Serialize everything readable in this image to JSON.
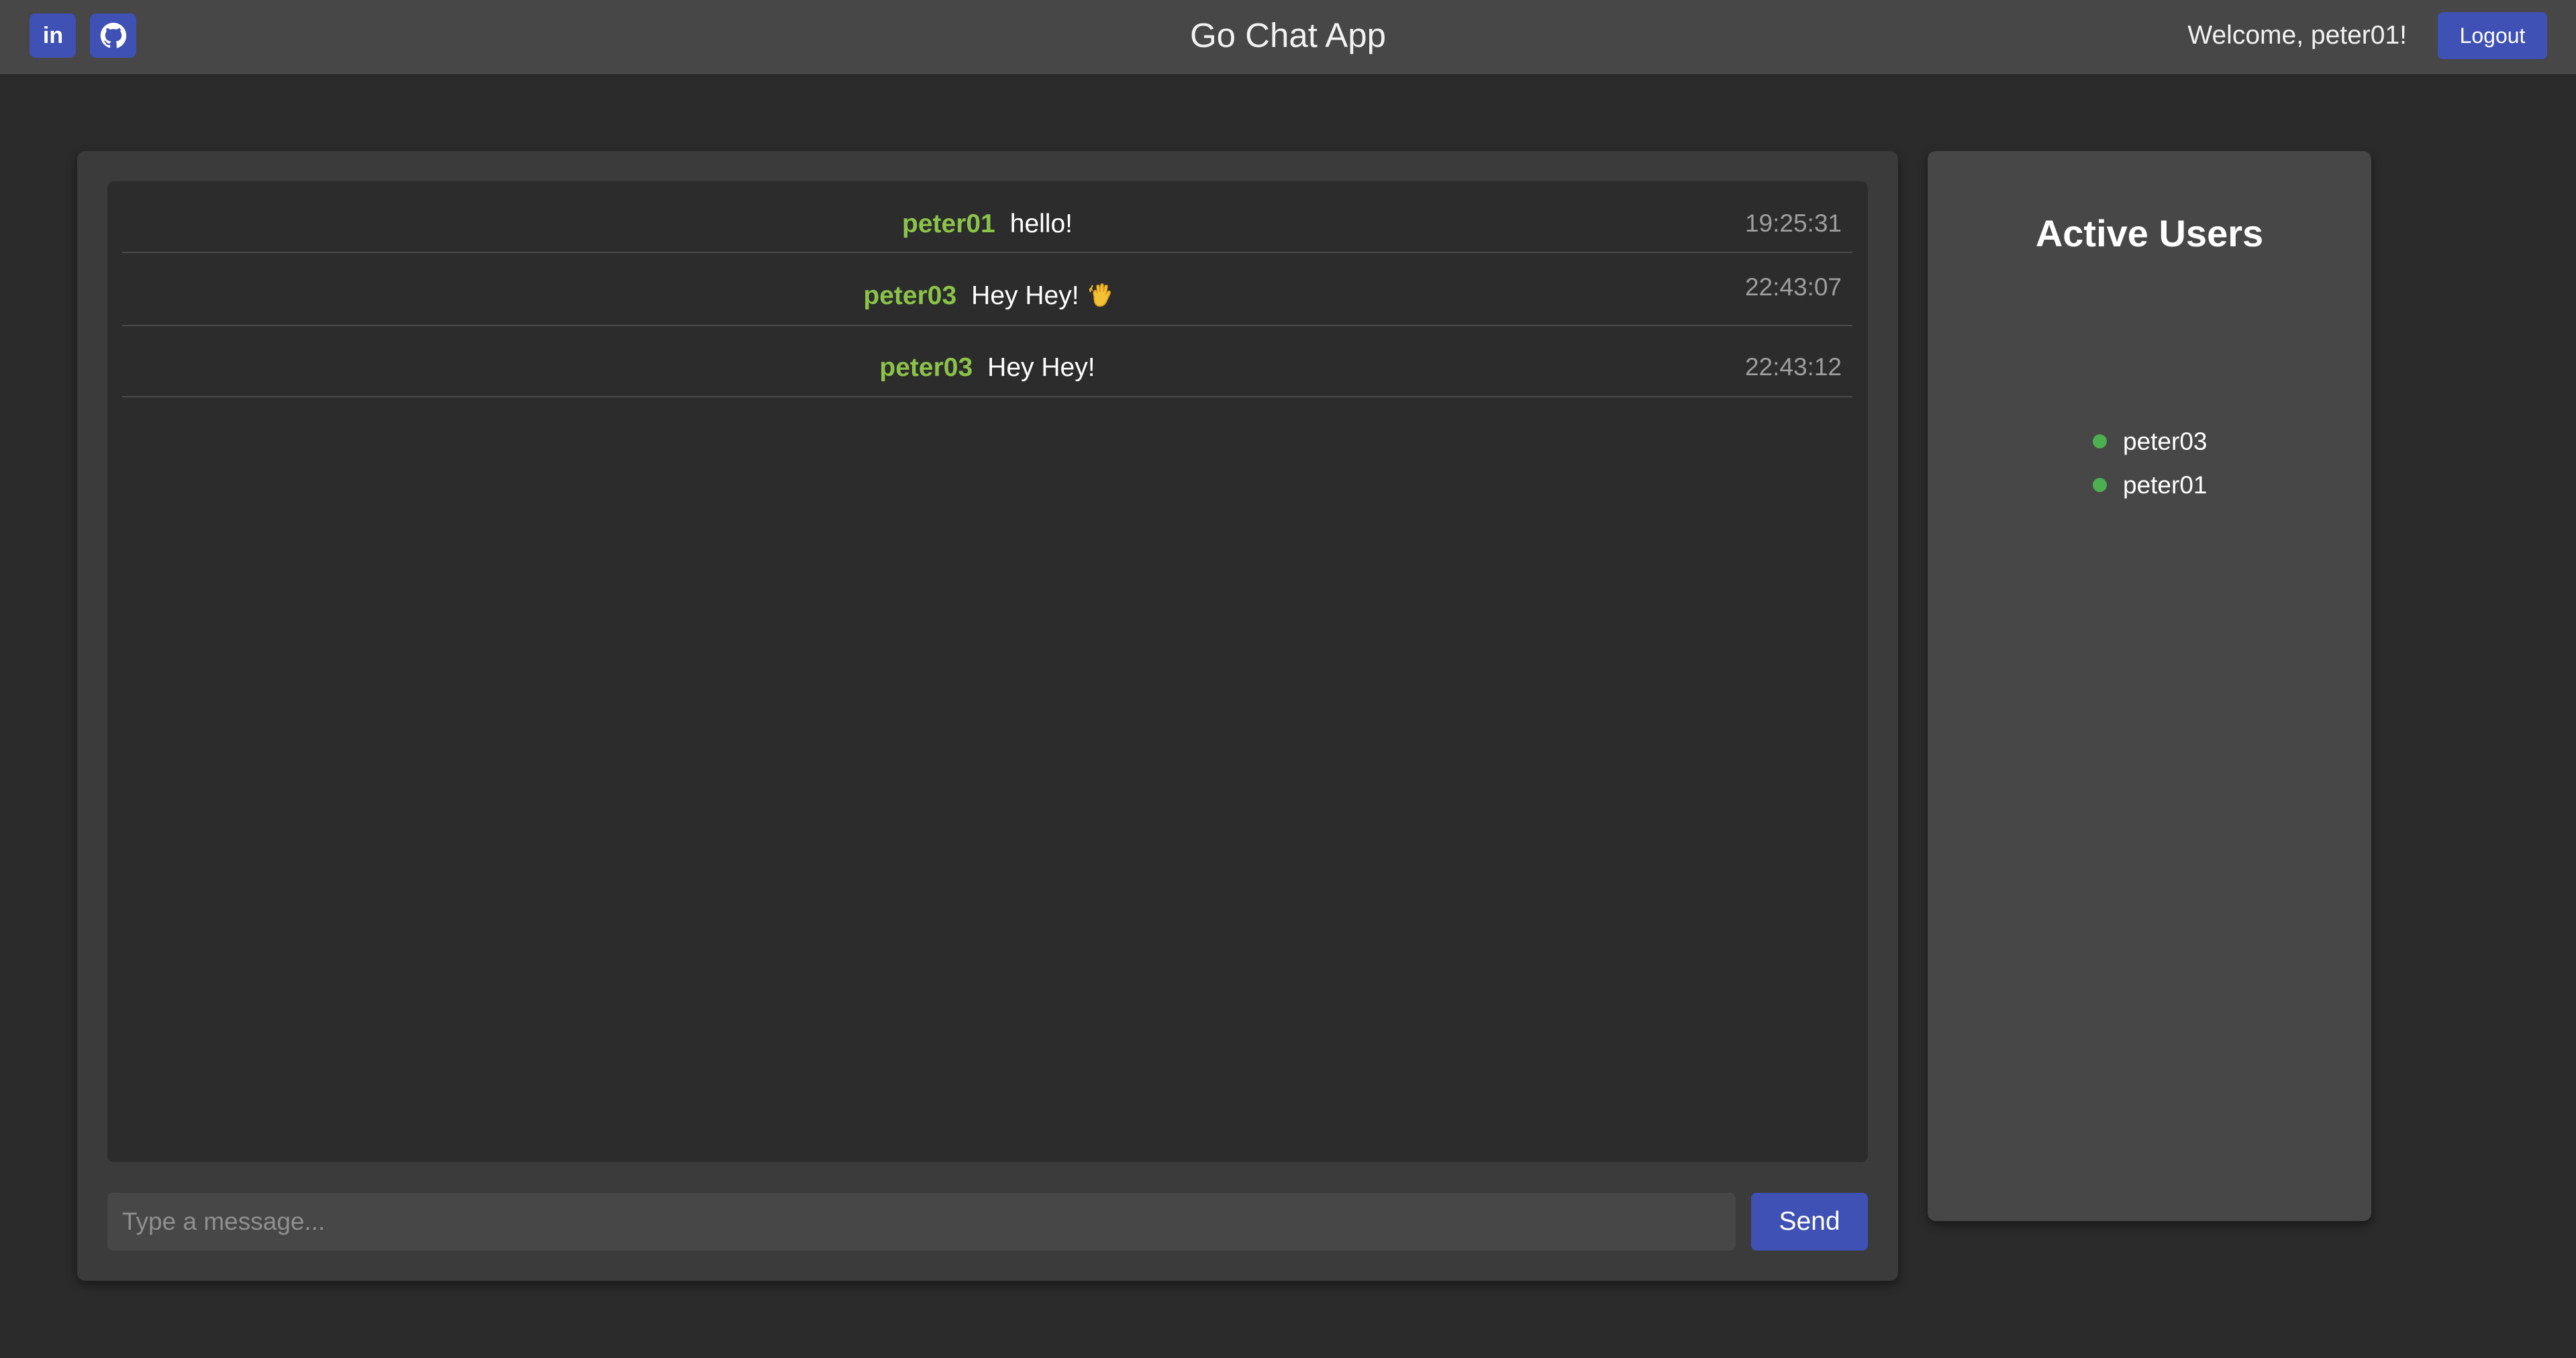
{
  "header": {
    "title": "Go Chat App",
    "welcome": "Welcome, peter01!",
    "logout_label": "Logout",
    "social": [
      {
        "icon": "linkedin-icon",
        "label": "in"
      },
      {
        "icon": "github-icon"
      }
    ]
  },
  "chat": {
    "messages": [
      {
        "user": "peter01",
        "text": "hello!",
        "time": "19:25:31"
      },
      {
        "user": "peter03",
        "text": "Hey Hey!",
        "emoji": "waving-hand-icon",
        "time": "22:43:07"
      },
      {
        "user": "peter03",
        "text": "Hey Hey!",
        "time": "22:43:12"
      }
    ],
    "input_placeholder": "Type a message...",
    "input_value": "",
    "send_label": "Send"
  },
  "sidebar": {
    "title": "Active Users",
    "users": [
      {
        "name": "peter03",
        "status": "online"
      },
      {
        "name": "peter01",
        "status": "online"
      }
    ]
  },
  "colors": {
    "accent": "#3f51b5",
    "username": "#8bc34a",
    "online": "#4caf50",
    "background": "#2b2b2b",
    "header": "#474747"
  }
}
